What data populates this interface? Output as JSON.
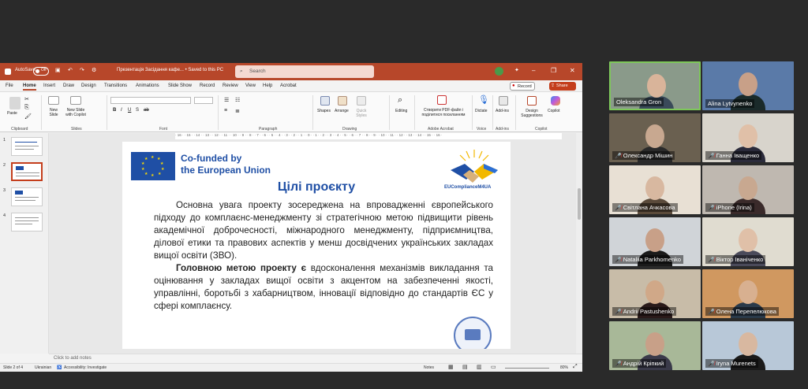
{
  "ppt": {
    "titlebar": {
      "autosave": "AutoSave",
      "autosave_state": "Off",
      "doc_title": "Презентація Засідання кафе... • Saved to this PC",
      "search_placeholder": "Search"
    },
    "tabs": [
      "File",
      "Home",
      "Insert",
      "Draw",
      "Design",
      "Transitions",
      "Animations",
      "Slide Show",
      "Record",
      "Review",
      "View",
      "Help",
      "Acrobat"
    ],
    "active_tab": "Home",
    "record_label": "Record",
    "share_label": "Share",
    "ribbon": {
      "paste": "Paste",
      "new_slide": "New Slide",
      "new_slide_copilot": "New Slide with Copilot",
      "shapes": "Shapes",
      "arrange": "Arrange",
      "quick_styles": "Quick Styles",
      "editing": "Editing",
      "create_pdf": "Створити PDF-файл і поділитися посиланням",
      "dictate": "Dictate",
      "addins": "Add-ins",
      "design_suggestions": "Design Suggestions",
      "copilot": "Copilot",
      "groups": [
        "Clipboard",
        "Slides",
        "Font",
        "Paragraph",
        "Drawing",
        "Adobe Acrobat",
        "Voice",
        "Add-ins",
        "Copilot"
      ]
    },
    "thumb_numbers": [
      "1",
      "2",
      "3",
      "4"
    ],
    "ruler": "· 16 · · 15 · · 14 · · 13 · · 12 · · 11 · · 10 · · 9 · · 8 · · 7 · · 6 · · 5 · · 4 · · 3 · · 2 · · 1 · · 0 · · 1 · · 2 · · 3 · · 4 · · 5 · · 6 · · 7 · · 8 · · 9 · · 10 · · 11 · · 12 · · 13 · · 14 · · 15 · · 16 ·",
    "notes_placeholder": "Click to add notes",
    "status": {
      "slide": "Slide 2 of 4",
      "language": "Ukrainian",
      "accessibility": "Accessibility: Investigate",
      "notes": "Notes",
      "zoom": "80%"
    }
  },
  "slide": {
    "eu_line1": "Co-funded by",
    "eu_line2": "the European Union",
    "title": "Цілі проєкту",
    "logo_text": "EUComplianceM4UA",
    "para1": "Основна увага проекту зосереджена на впровадженні європейського підходу до комплаєнс-менеджменту зі стратегічною метою підвищити рівень академічної доброчесності, міжнародного менеджменту, підприємництва, ділової етики та правових аспектів у менш досвідчених українських закладах вищої освіти (ЗВО).",
    "para2_bold": "Головною метою проекту є",
    "para2_rest": " вдосконалення механізмів викладання та оцінювання у закладах вищої освіти з акцентом на забезпеченні якості, управлінні, боротьбі з хабарництвом, інновації відповідно до стандартів ЄС у сфері комплаєнсу."
  },
  "participants": [
    {
      "name": "Oleksandra Gron",
      "muted": false,
      "speaking": true
    },
    {
      "name": "Alina Lytvynenko",
      "muted": false,
      "speaking": false
    },
    {
      "name": "Олександр Мішин",
      "muted": true,
      "speaking": false
    },
    {
      "name": "Ганна Іващенко",
      "muted": true,
      "speaking": false
    },
    {
      "name": "Світлана Ачкасова",
      "muted": true,
      "speaking": false
    },
    {
      "name": "iPhone (Irina)",
      "muted": true,
      "speaking": false
    },
    {
      "name": "Nataliia Parkhomenko",
      "muted": true,
      "speaking": false
    },
    {
      "name": "Віктор Іваніченко",
      "muted": true,
      "speaking": false
    },
    {
      "name": "Andrii Pastushenko",
      "muted": true,
      "speaking": false
    },
    {
      "name": "Олена Перепелюкова",
      "muted": true,
      "speaking": false
    },
    {
      "name": "Андрій Кріпкий",
      "muted": true,
      "speaking": false
    },
    {
      "name": "Iryna Murenets",
      "muted": true,
      "speaking": false
    }
  ],
  "colors": {
    "ppt_accent": "#b7472a",
    "slide_blue": "#1f4fa5",
    "speaking_border": "#7ec85a"
  }
}
